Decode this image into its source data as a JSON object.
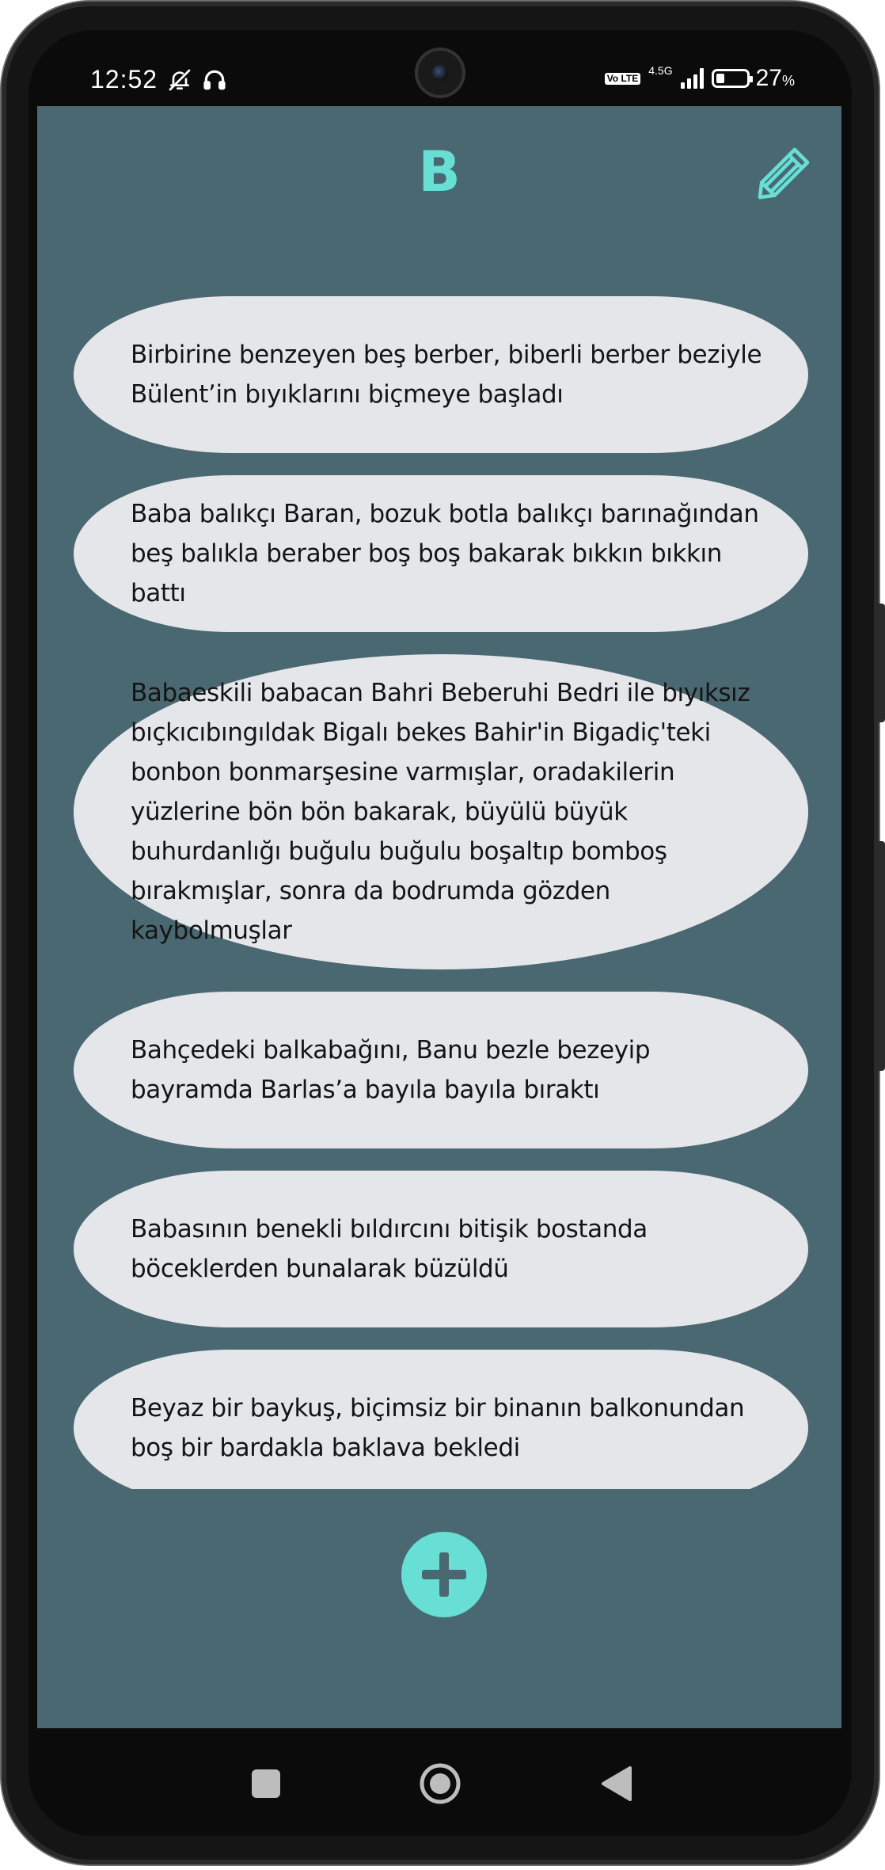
{
  "status_bar": {
    "time": "12:52",
    "network_type": "4.5G",
    "volte": "Vo LTE",
    "battery_percent": "27",
    "battery_unit": "%",
    "icons": [
      "bell-off-icon",
      "headphones-icon",
      "signal-icon",
      "battery-icon"
    ]
  },
  "header": {
    "title": "B",
    "edit_icon": "pencil-icon"
  },
  "cards": [
    "Birbirine benzeyen beş berber, biberli berber beziyle Bülent’in bıyıklarını biçmeye başladı",
    "Baba balıkçı Baran, bozuk botla balıkçı barınağından beş balıkla beraber boş boş bakarak bıkkın bıkkın battı",
    "Babaeskili babacan Bahri Beberuhi Bedri ile bıyıksız bıçkıcıbıngıldak Bigalı bekes Bahir'in Bigadiç'teki bonbon bonmarşesine varmışlar, oradakilerin yüzlerine bön bön bakarak, büyülü büyük buhurdanlığı buğulu buğulu boşaltıp bomboş bırakmışlar, sonra da bodrumda gözden kaybolmuşlar",
    "Bahçedeki balkabağını, Banu bezle bezeyip bayramda Barlas’a bayıla bayıla bıraktı",
    "Babasının benekli bıldırcını bitişik bostanda böceklerden bunalarak büzüldü",
    "Beyaz bir baykuş, biçimsiz bir binanın balkonundan boş bir bardakla baklava bekledi"
  ],
  "fab": {
    "icon": "plus-icon"
  },
  "navigation": {
    "icons": [
      "square-recents-icon",
      "circle-home-icon",
      "triangle-back-icon"
    ]
  },
  "colors": {
    "background": "#4a6871",
    "accent": "#67dfd4",
    "card": "#e5e6ea"
  }
}
